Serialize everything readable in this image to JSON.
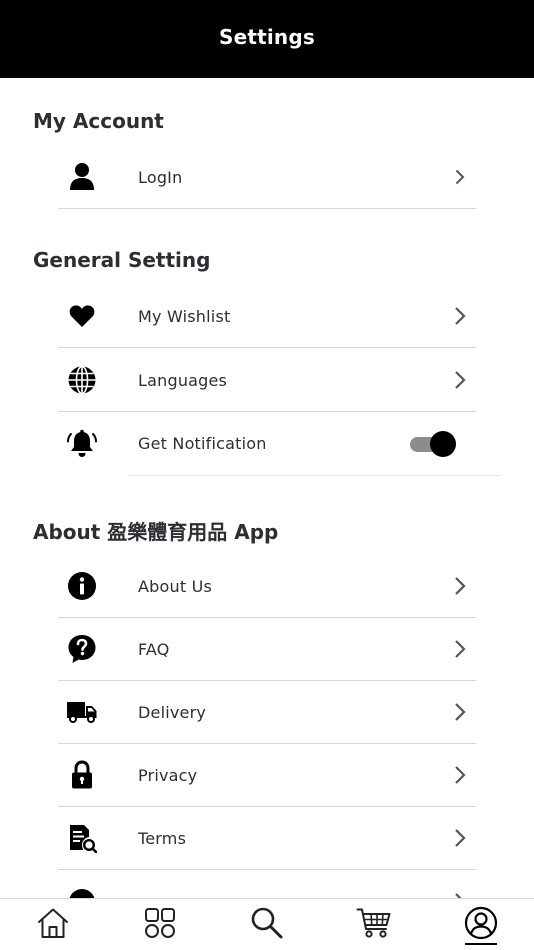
{
  "header": {
    "title": "Settings"
  },
  "sections": {
    "account": {
      "title": "My Account"
    },
    "general": {
      "title": "General Setting"
    },
    "about": {
      "title": "About 盈樂體育用品 App"
    }
  },
  "rows": {
    "login": "LogIn",
    "wishlist": "My Wishlist",
    "languages": "Languages",
    "notification": "Get Notification",
    "about_us": "About Us",
    "faq": "FAQ",
    "delivery": "Delivery",
    "privacy": "Privacy",
    "terms": "Terms"
  },
  "notification_enabled": true,
  "tabbar": {
    "items": [
      "home-icon",
      "categories-icon",
      "search-icon",
      "cart-icon",
      "profile-icon"
    ],
    "active": "profile-icon"
  },
  "colors": {
    "header_bg": "#000000",
    "text": "#2b2f33",
    "divider": "#d4d6d8",
    "toggle_track": "#8c8c8c"
  }
}
